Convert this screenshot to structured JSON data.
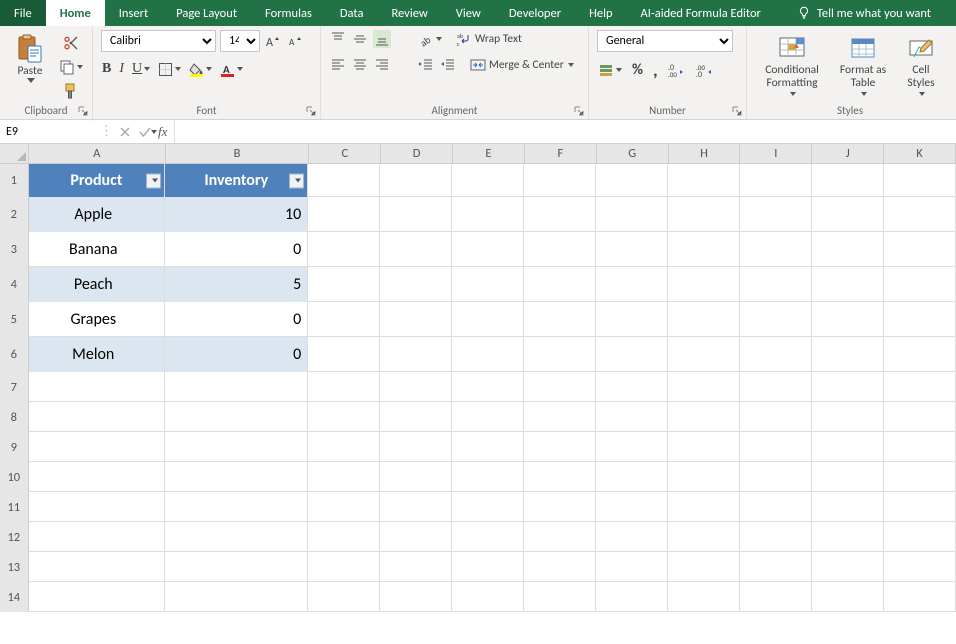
{
  "tabs": {
    "file": "File",
    "home": "Home",
    "insert": "Insert",
    "page_layout": "Page Layout",
    "formulas": "Formulas",
    "data": "Data",
    "review": "Review",
    "view": "View",
    "developer": "Developer",
    "help": "Help",
    "ai_formula": "AI-aided Formula Editor",
    "tellme": "Tell me what you want"
  },
  "ribbon": {
    "clipboard": {
      "paste": "Paste",
      "label": "Clipboard"
    },
    "font": {
      "name": "Calibri",
      "size": "14",
      "label": "Font"
    },
    "alignment": {
      "wrap": "Wrap Text",
      "merge": "Merge & Center",
      "label": "Alignment"
    },
    "number": {
      "format": "General",
      "label": "Number"
    },
    "styles": {
      "cond": "Conditional\nFormatting",
      "fmtas": "Format as\nTable",
      "cell": "Cell\nStyles",
      "label": "Styles"
    }
  },
  "bar": {
    "namebox": "E9"
  },
  "grid": {
    "rowHeader": 30,
    "colWidths": {
      "A": 143,
      "B": 150,
      "C": 75,
      "D": 75,
      "E": 75,
      "F": 75,
      "G": 75,
      "H": 75,
      "I": 75,
      "J": 75,
      "K": 75
    },
    "headerRowH": 33,
    "dataRowH": 35,
    "emptyRowH": 30,
    "cols": [
      "A",
      "B",
      "C",
      "D",
      "E",
      "F",
      "G",
      "H",
      "I",
      "J",
      "K"
    ],
    "rowCount": 14,
    "table": {
      "headers": [
        "Product",
        "Inventory"
      ],
      "rows": [
        {
          "product": "Apple",
          "inventory": "10"
        },
        {
          "product": "Banana",
          "inventory": "0"
        },
        {
          "product": "Peach",
          "inventory": "5"
        },
        {
          "product": "Grapes",
          "inventory": "0"
        },
        {
          "product": "Melon",
          "inventory": "0"
        }
      ]
    }
  }
}
